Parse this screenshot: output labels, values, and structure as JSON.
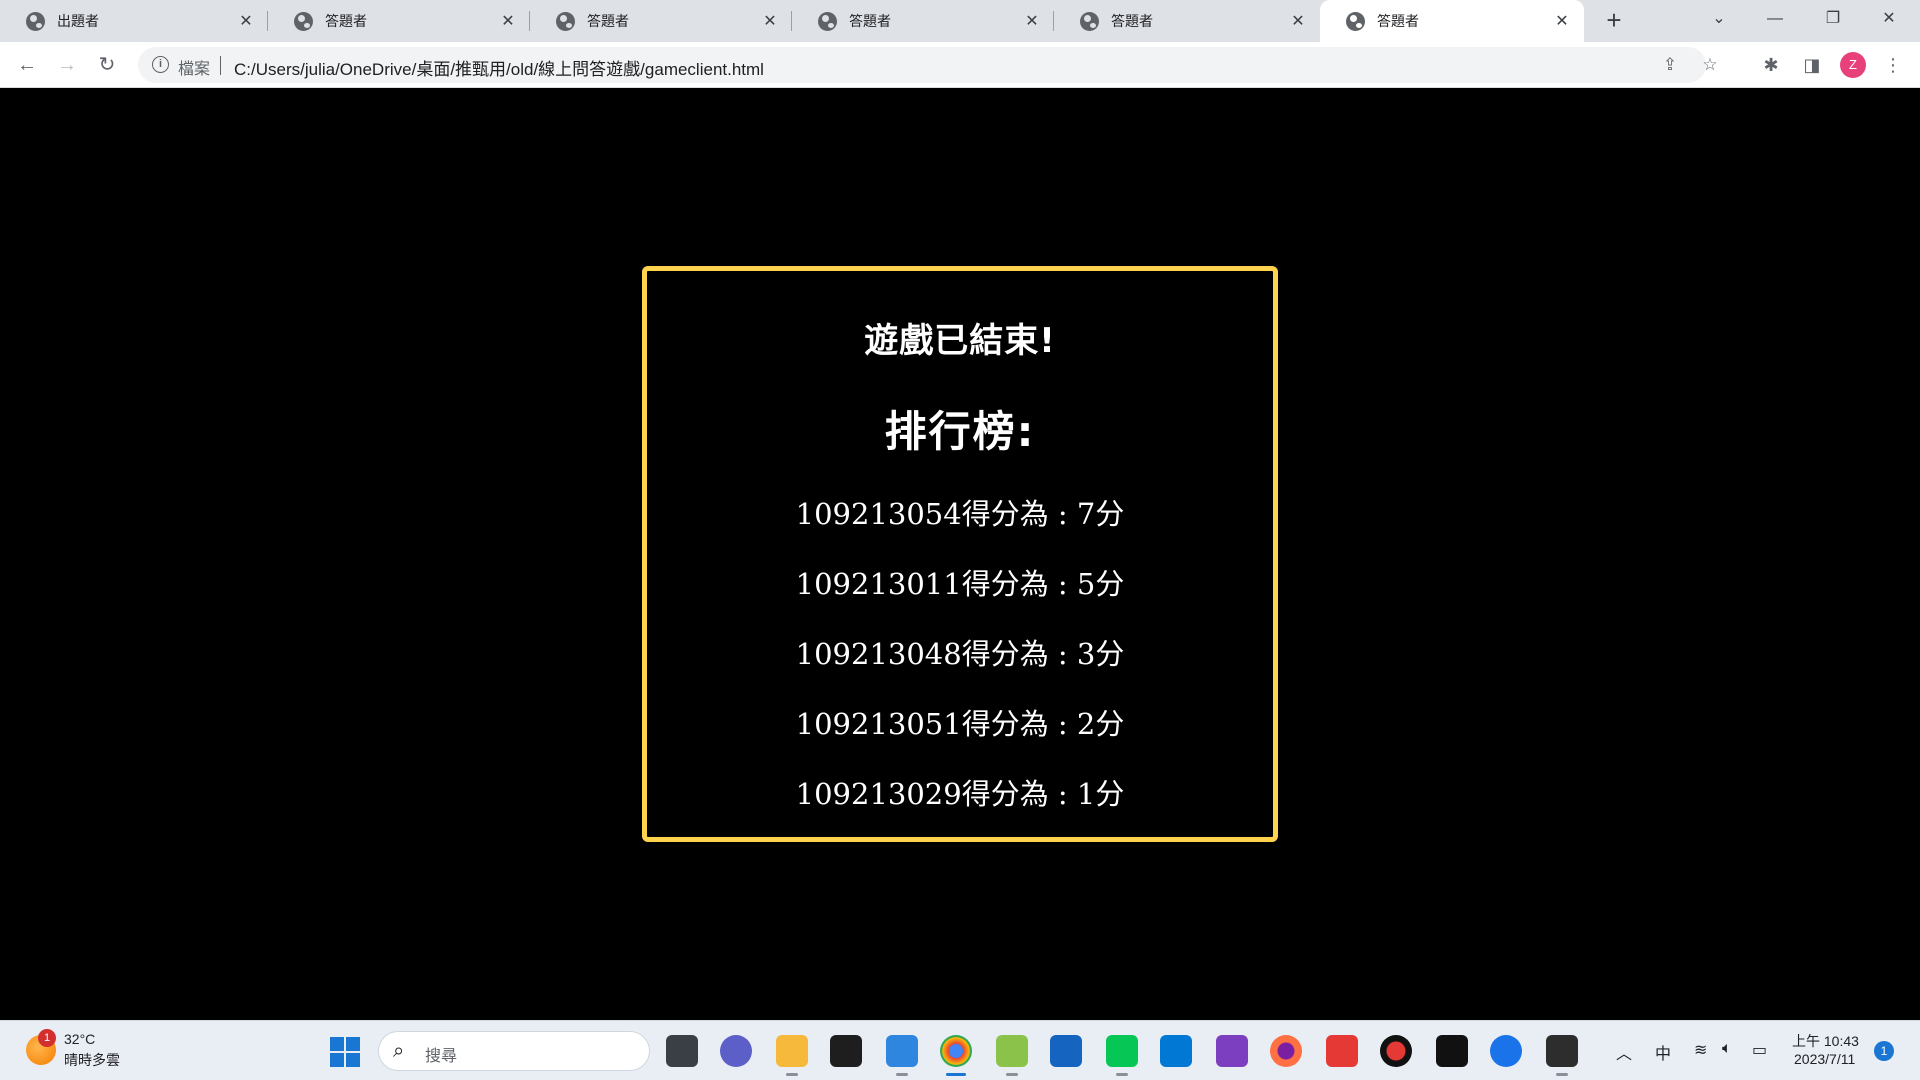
{
  "browser": {
    "tabs": [
      {
        "title": "出題者",
        "active": false
      },
      {
        "title": "答題者",
        "active": false
      },
      {
        "title": "答題者",
        "active": false
      },
      {
        "title": "答題者",
        "active": false
      },
      {
        "title": "答題者",
        "active": false
      },
      {
        "title": "答題者",
        "active": true
      }
    ],
    "address": {
      "scheme_label": "檔案",
      "url": "C:/Users/julia/OneDrive/桌面/推甄用/old/線上問答遊戲/gameclient.html"
    },
    "profile_initial": "Z"
  },
  "game": {
    "over_title": "遊戲已結束!",
    "leaderboard_title": "排行榜:",
    "leaderboard": [
      {
        "text": "109213054得分為 : 7分"
      },
      {
        "text": "109213011得分為 : 5分"
      },
      {
        "text": "109213048得分為 : 3分"
      },
      {
        "text": "109213051得分為 : 2分"
      },
      {
        "text": "109213029得分為 : 1分"
      }
    ],
    "border_color": "#ffd34d"
  },
  "taskbar": {
    "weather": {
      "temp": "32°C",
      "desc": "晴時多雲",
      "badge": "1"
    },
    "search_placeholder": "搜尋",
    "ime": "中",
    "clock": {
      "time": "上午 10:43",
      "date": "2023/7/11"
    },
    "notifications": "1"
  }
}
